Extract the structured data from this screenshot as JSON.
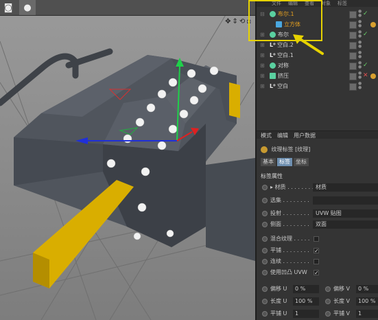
{
  "menubar": [
    "文件",
    "编辑",
    "查看",
    "对象",
    "标签",
    "书"
  ],
  "objects": [
    {
      "tree": "⊟",
      "name": "布尔.1",
      "color": "#5ad0a0",
      "state": "✓",
      "state_color": "#6ad06a",
      "highlight": true
    },
    {
      "tree": "",
      "name": "立方体",
      "color": "#4aa8e0",
      "state": "",
      "state_color": "#6ad06a",
      "highlight": true,
      "indent": true
    },
    {
      "tree": "⊞",
      "name": "布尔",
      "color": "#5ad0a0",
      "state": "✓",
      "state_color": "#6ad06a"
    },
    {
      "tree": "⊞",
      "name": "空白.2",
      "color": "#e8e8e8",
      "state": "",
      "state_color": "#6ad06a",
      "lo": true
    },
    {
      "tree": "⊞",
      "name": "空白.1",
      "color": "#e8e8e8",
      "state": "",
      "state_color": "#6ad06a",
      "lo": true
    },
    {
      "tree": "⊞",
      "name": "对称",
      "color": "#5ad0a0",
      "state": "✓",
      "state_color": "#6ad06a"
    },
    {
      "tree": "⊞",
      "name": "挤压",
      "color": "#5ad0a0",
      "state": "✕",
      "state_color": "#e05050"
    },
    {
      "tree": "⊞",
      "name": "空白",
      "color": "#e8e8e8",
      "state": "",
      "state_color": "#6ad06a",
      "lo": true
    }
  ],
  "attr_menu": [
    "模式",
    "编辑",
    "用户数据"
  ],
  "tag_title": "纹理标签 [纹理]",
  "tabs": [
    "基本",
    "标签",
    "坐标"
  ],
  "section_title": "标签属性",
  "props": [
    {
      "label": "▸ 材质 . . . . . . . .",
      "value": "材质"
    },
    {
      "label": "选集 . . . . . . . .",
      "value": ""
    },
    {
      "label": "投射 . . . . . . . .",
      "value": "UVW 贴图"
    },
    {
      "label": "侧面 . . . . . . . .",
      "value": "双面"
    }
  ],
  "checks": [
    {
      "label": "混合纹理 . . . . .",
      "checked": ""
    },
    {
      "label": "平铺 . . . . . . . .",
      "checked": "✓"
    },
    {
      "label": "连续 . . . . . . . .",
      "checked": ""
    },
    {
      "label": "使用凹凸 UVW",
      "checked": "✓"
    }
  ],
  "uv_rows": [
    {
      "left_label": "偏移 U",
      "left_value": "0 %",
      "right_label": "偏移 V",
      "right_value": "0 %"
    },
    {
      "left_label": "长度 U",
      "left_value": "100 %",
      "right_label": "长度 V",
      "right_value": "100 %"
    },
    {
      "left_label": "平铺 U",
      "left_value": "1",
      "right_label": "平铺 V",
      "right_value": "1"
    }
  ]
}
